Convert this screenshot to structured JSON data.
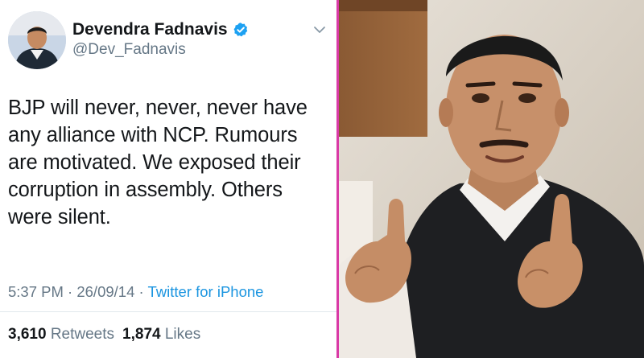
{
  "tweet": {
    "display_name": "Devendra Fadnavis",
    "handle": "@Dev_Fadnavis",
    "verified": true,
    "text": "BJP will never, never, never have any alliance with NCP. Rumours are motivated. We exposed their corruption in assembly. Others were silent.",
    "time": "5:37 PM",
    "separator": "·",
    "date": "26/09/14",
    "source": "Twitter for iPhone",
    "retweets_count": "3,610",
    "retweets_label": "Retweets",
    "likes_count": "1,874",
    "likes_label": "Likes"
  },
  "colors": {
    "verified_badge": "#1da1f2",
    "link": "#1b95e0",
    "divider": "#d93aa6"
  },
  "icons": [
    "verified-badge-icon",
    "chevron-down-icon"
  ]
}
